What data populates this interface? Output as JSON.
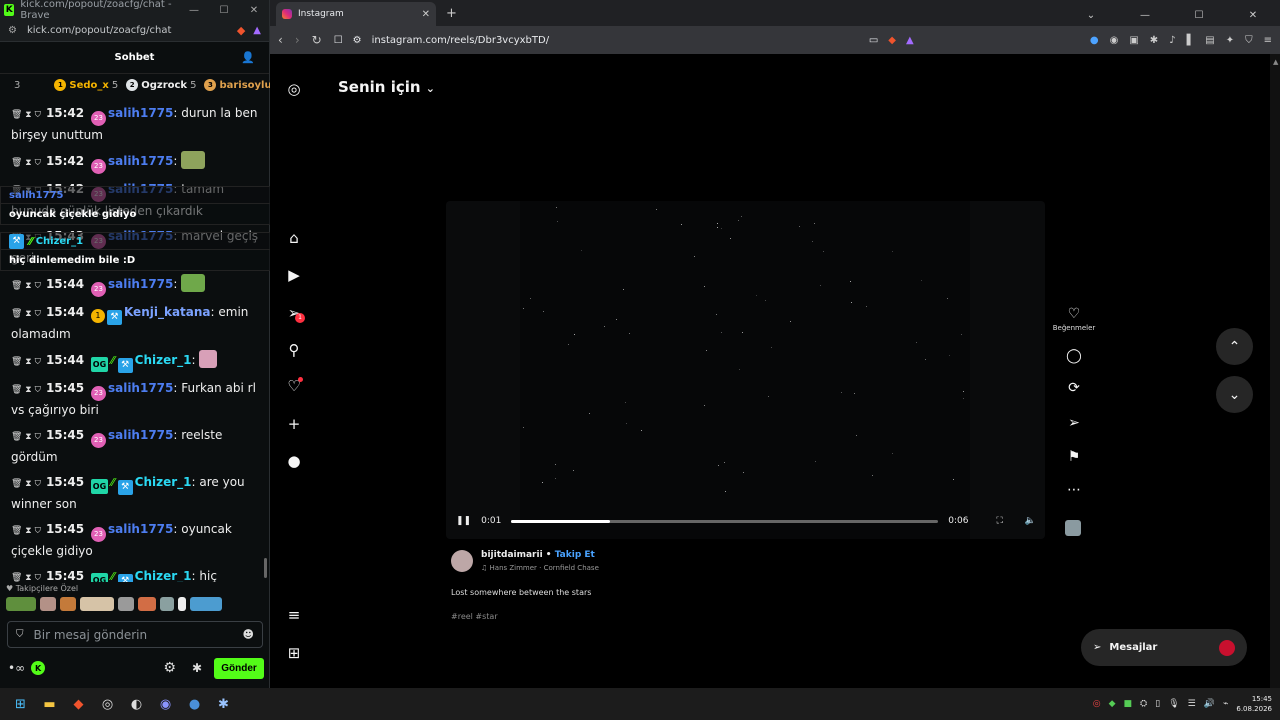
{
  "kick": {
    "title": "kick.com/popout/zoacfg/chat - Brave",
    "url": "kick.com/popout/zoacfg/chat",
    "header": "Sohbet",
    "leaderboard": {
      "count": "3",
      "items": [
        {
          "rank": "1",
          "name": "Sedo_x",
          "extra": "5",
          "color": "#f5b400"
        },
        {
          "rank": "2",
          "name": "Ogzrock",
          "extra": "5",
          "color": "#dfe3e6"
        },
        {
          "rank": "3",
          "name": "barisoylu",
          "extra": "",
          "color": "#e0a14d"
        }
      ]
    },
    "messages": [
      {
        "time": "15:42",
        "badge": "sub",
        "user": "salih1775",
        "cls": "s",
        "text": "durun la ben birşey unuttum",
        "emote": ""
      },
      {
        "time": "15:42",
        "badge": "sub",
        "user": "salih1775",
        "cls": "s",
        "text": "",
        "emote": "map"
      },
      {
        "time": "15:42",
        "badge": "sub",
        "user": "salih1775",
        "cls": "s",
        "text": "tamam bunuda günlük listeden çıkardık",
        "emote": ""
      },
      {
        "time": "15:43",
        "badge": "sub",
        "user": "salih1775",
        "cls": "s",
        "text": "marvel geçiş geri",
        "emote": ""
      },
      {
        "time": "15:44",
        "badge": "sub",
        "user": "salih1775",
        "cls": "s",
        "text": "",
        "emote": "pepe"
      },
      {
        "time": "15:44",
        "badge": "gold",
        "user": "Kenji_katana",
        "cls": "k",
        "text": "emin olamadım",
        "emote": ""
      },
      {
        "time": "15:44",
        "badge": "og",
        "user": "Chizer_1",
        "cls": "c",
        "text": "",
        "emote": "pink"
      },
      {
        "time": "15:45",
        "badge": "sub",
        "user": "salih1775",
        "cls": "s",
        "text": "Furkan abi rl vs çağırıyo biri",
        "emote": ""
      },
      {
        "time": "15:45",
        "badge": "sub",
        "user": "salih1775",
        "cls": "s",
        "text": "reelste gördüm",
        "emote": ""
      },
      {
        "time": "15:45",
        "badge": "og",
        "user": "Chizer_1",
        "cls": "c",
        "text": "are you winner son",
        "emote": ""
      },
      {
        "time": "15:45",
        "badge": "sub",
        "user": "salih1775",
        "cls": "s",
        "text": "oyuncak çiçekle gidiyo",
        "emote": ""
      },
      {
        "time": "15:45",
        "badge": "og",
        "user": "Chizer_1",
        "cls": "c",
        "text": "hiç dinlemedim bile :D",
        "emote": ""
      }
    ],
    "overlay": {
      "user1": "salih1775",
      "text1": "oyuncak çiçekle gidiyo",
      "user2": "Chizer_1",
      "text2": "hiç dinlemedim bile :D"
    },
    "emotes_label": "Takipçilere Özel",
    "input_placeholder": "Bir mesaj gönderin",
    "send_label": "Gönder"
  },
  "brave": {
    "tab_title": "Instagram",
    "url": "instagram.com/reels/Dbr3vcyxbTD/"
  },
  "instagram": {
    "feed_title": "Senin için",
    "notif_count": "1",
    "video": {
      "current": "0:01",
      "duration": "0:06",
      "progress": 0.23
    },
    "author": "bijitdaimarii",
    "follow": "Takip Et",
    "song": "Hans Zimmer · Cornfield Chase",
    "caption": "Lost somewhere between the stars",
    "tags": "#reel #star",
    "likes_label": "Beğenmeler",
    "messages_label": "Mesajlar",
    "messages_badge": "1"
  },
  "taskbar": {
    "time": "15:45",
    "date": "6.08.2026"
  }
}
